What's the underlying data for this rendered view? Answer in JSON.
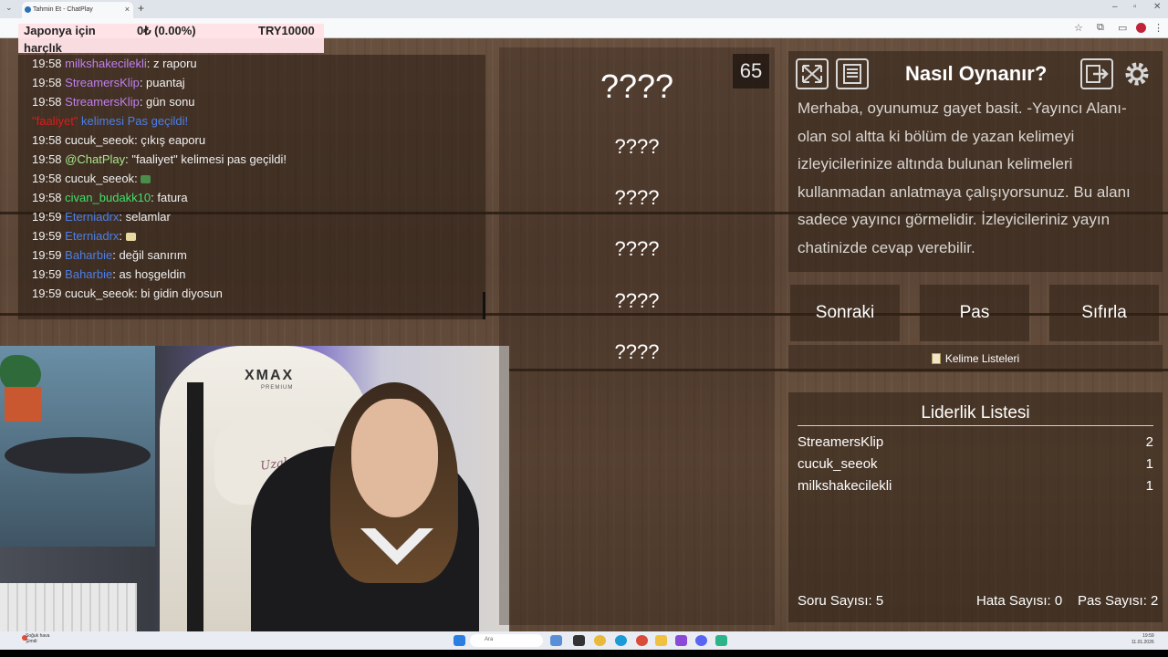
{
  "browser": {
    "tab_title": "Tahmin Et - ChatPlay",
    "tab_close": "×",
    "new_tab": "+",
    "tab_menu": "⌄"
  },
  "overlay": {
    "line1": "Japonya için",
    "line2": "harçlık",
    "amount": "0₺ (0.00%)",
    "goal": "TRY10000"
  },
  "chat": {
    "messages": [
      {
        "time": "19:58",
        "user": "milkshakecilekli",
        "user_color": "purple",
        "text": ": z raporu"
      },
      {
        "time": "19:58",
        "user": "StreamersKlip",
        "user_color": "purple",
        "text": ": puantaj"
      },
      {
        "time": "19:58",
        "user": "StreamersKlip",
        "user_color": "purple",
        "text": ": gün sonu"
      },
      {
        "time": "",
        "user": "\"faaliyet\"",
        "user_color": "red",
        "text": " kelimesi Pas geçildi!"
      },
      {
        "time": "19:58",
        "user": "cucuk_seeok",
        "user_color": "",
        "text": ": çıkış eaporu"
      },
      {
        "time": "19:58",
        "user": "@ChatPlay",
        "user_color": "lime",
        "text": ": \"faaliyet\" kelimesi pas geçildi!"
      },
      {
        "time": "19:58",
        "user": "cucuk_seeok",
        "user_color": "",
        "text": ": "
      },
      {
        "time": "19:58",
        "user": "civan_budakk10",
        "user_color": "green",
        "text": ": fatura"
      },
      {
        "time": "19:59",
        "user": "Eterniadrx",
        "user_color": "blue",
        "text": ": selamlar"
      },
      {
        "time": "19:59",
        "user": "Eterniadrx",
        "user_color": "blue",
        "text": ": "
      },
      {
        "time": "19:59",
        "user": "Baharbie",
        "user_color": "blue",
        "text": ": değil sanırım"
      },
      {
        "time": "19:59",
        "user": "Baharbie",
        "user_color": "blue",
        "text": ": as hoşgeldin"
      },
      {
        "time": "19:59",
        "user": "cucuk_seeok",
        "user_color": "",
        "text": ": bi gidin diyosun"
      }
    ]
  },
  "webcam": {
    "chair_brand": "XMAX",
    "chair_sub": "PREMIUM",
    "pillow_text": "Uzaktan Asyalı"
  },
  "game": {
    "timer": "65",
    "words": [
      "????",
      "????",
      "????",
      "????",
      "????",
      "????"
    ],
    "help_title": "Nasıl Oynanır?",
    "help_body": "Merhaba, oyunumuz gayet basit. -Yayıncı Alanı- olan sol altta ki bölüm de yazan kelimeyi izleyicilerinize altında bulunan kelimeleri kullanmadan anlatmaya çalışıyorsunuz. Bu alanı sadece yayıncı görmelidir. İzleyicileriniz yayın chatinizde cevap verebilir.",
    "buttons": {
      "next": "Sonraki",
      "pass": "Pas",
      "reset": "Sıfırla"
    },
    "word_lists": "Kelime Listeleri",
    "leaderboard": {
      "title": "Liderlik Listesi",
      "rows": [
        {
          "name": "StreamersKlip",
          "score": "2"
        },
        {
          "name": "cucuk_seeok",
          "score": "1"
        },
        {
          "name": "milkshakecilekli",
          "score": "1"
        }
      ]
    },
    "stats": {
      "questions": "Soru Sayısı: 5",
      "errors": "Hata Sayısı: 0",
      "passes": "Pas Sayısı: 2"
    }
  },
  "taskbar": {
    "weather_line1": "Soğuk hava",
    "weather_line2": "Şimdi",
    "search": "Ara",
    "time": "19:59",
    "date": "11.01.2026"
  },
  "colors": {
    "purple": "#c07ff0",
    "green": "#3fe06a",
    "blue": "#4c7fe8",
    "lime": "#a8e88a",
    "red": "#e01a1a"
  }
}
